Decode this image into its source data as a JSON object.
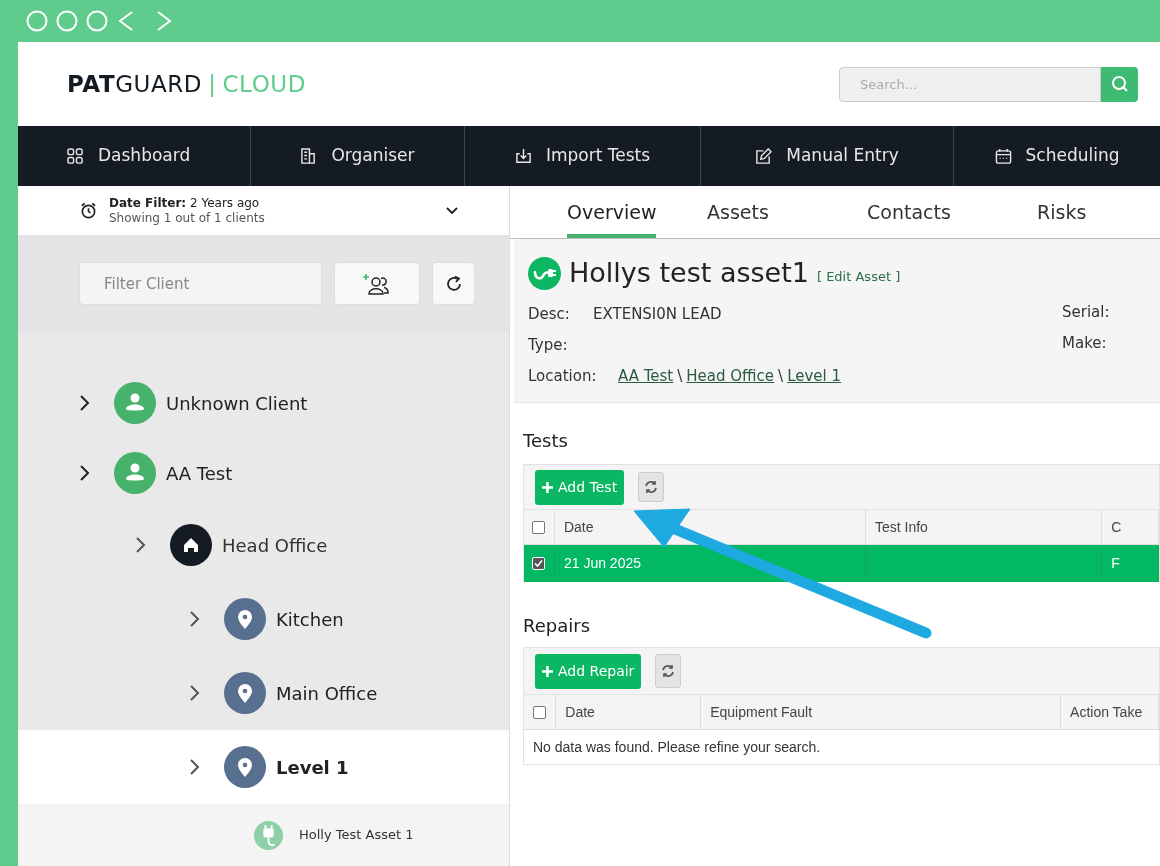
{
  "logo": {
    "brand": "PATGUARD",
    "divider": "|",
    "product": "CLOUD"
  },
  "search": {
    "placeholder": "Search..."
  },
  "nav": [
    {
      "label": "Dashboard"
    },
    {
      "label": "Organiser"
    },
    {
      "label": "Import Tests"
    },
    {
      "label": "Manual Entry"
    },
    {
      "label": "Scheduling"
    }
  ],
  "date_filter": {
    "label": "Date Filter:",
    "value": "2 Years ago",
    "summary": "Showing 1 out of 1 clients"
  },
  "filter": {
    "placeholder": "Filter Client"
  },
  "tree": [
    {
      "label": "Unknown Client",
      "kind": "client",
      "selected": false
    },
    {
      "label": "AA Test",
      "kind": "client",
      "selected": false,
      "children": [
        {
          "label": "Head Office",
          "kind": "site",
          "selected": false,
          "children": [
            {
              "label": "Kitchen",
              "kind": "location",
              "selected": false
            },
            {
              "label": "Main Office",
              "kind": "location",
              "selected": false
            },
            {
              "label": "Level 1",
              "kind": "location",
              "selected": true,
              "children": [
                {
                  "label": "Holly Test Asset 1",
                  "kind": "asset",
                  "selected": false
                }
              ]
            }
          ]
        }
      ]
    }
  ],
  "tabs": [
    {
      "label": "Overview",
      "selected": true
    },
    {
      "label": "Assets",
      "selected": false
    },
    {
      "label": "Contacts",
      "selected": false
    },
    {
      "label": "Risks",
      "selected": false
    }
  ],
  "asset": {
    "name": "Hollys test asset1",
    "edit": "[ Edit Asset ]",
    "fields": [
      {
        "label": "Desc:",
        "value": "EXTENSI0N LEAD"
      },
      {
        "label": "Type:"
      }
    ],
    "right_fields": [
      {
        "label": "Serial:"
      },
      {
        "label": "Make:"
      }
    ],
    "location_label": "Location:",
    "location": [
      "AA Test",
      "Head Office",
      "Level 1"
    ],
    "separator": "\\"
  },
  "tests": {
    "title": "Tests",
    "add": "Add Test",
    "all_checked": false,
    "columns": [
      "Date",
      "Test Info",
      "C"
    ],
    "rows": [
      {
        "checked": true,
        "cells": [
          "21 Jun 2025",
          "",
          "F"
        ]
      }
    ]
  },
  "repairs": {
    "title": "Repairs",
    "add": "Add Repair",
    "all_checked": false,
    "columns": [
      "Date",
      "Equipment Fault",
      "Action Take"
    ],
    "empty": "No data was found. Please refine your search."
  }
}
